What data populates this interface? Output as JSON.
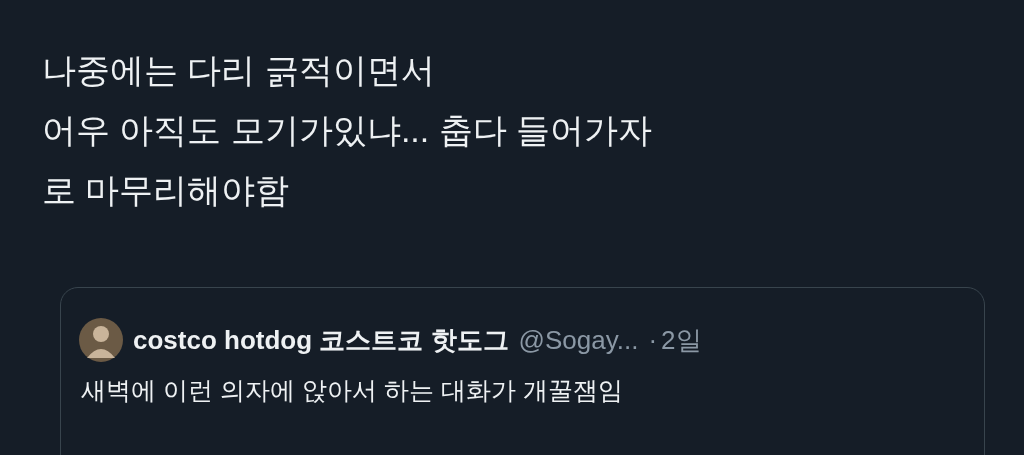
{
  "tweet": {
    "lines": [
      "나중에는 다리 긁적이면서",
      "어우 아직도 모기가있냐... 춥다 들어가자",
      "로 마무리해야함"
    ]
  },
  "quote": {
    "name": "costco hotdog 코스트코 핫도그",
    "handle": "@Sogay...",
    "separator": "·",
    "time": "2일",
    "text": "새벽에 이런 의자에 앉아서 하는 대화가 개꿀잼임"
  }
}
